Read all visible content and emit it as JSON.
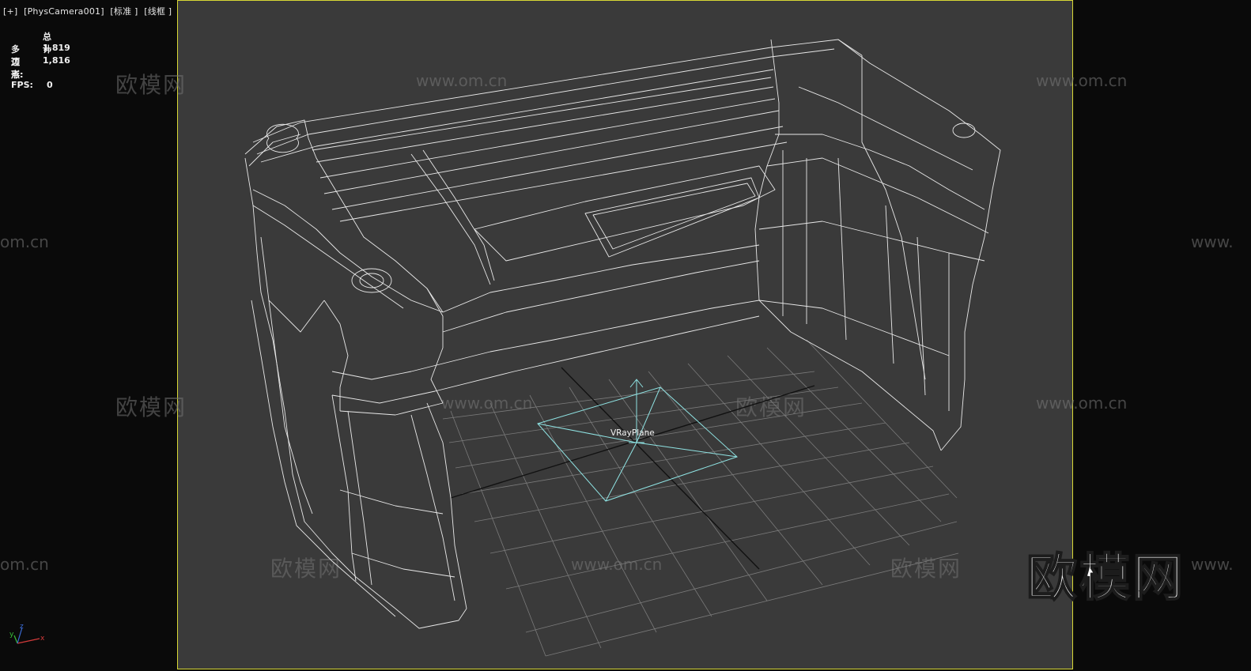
{
  "viewport": {
    "labels": [
      "[+]",
      "[PhysCamera001]",
      "[标准 ]",
      "[线框 ]"
    ]
  },
  "stats": {
    "header": "总计",
    "polygons_label": "多边形:",
    "polygons_value": "1,819",
    "vertices_label": "顶点:",
    "vertices_value": "1,816",
    "fps_label": "FPS:",
    "fps_value": "0"
  },
  "object_label": "VRayPlane",
  "watermarks": {
    "cn": "欧模网",
    "url": "www.om.cn",
    "url_partial": "om.cn",
    "url_partial_right": "www."
  },
  "brand": "欧模网",
  "axis": {
    "x": "x",
    "y": "y",
    "z": "z"
  },
  "colors": {
    "safe_frame": "#d8d835",
    "viewport_bg": "#3a3a3a",
    "wireframe": "#e8e8e8",
    "light": "#8fe3e3"
  }
}
